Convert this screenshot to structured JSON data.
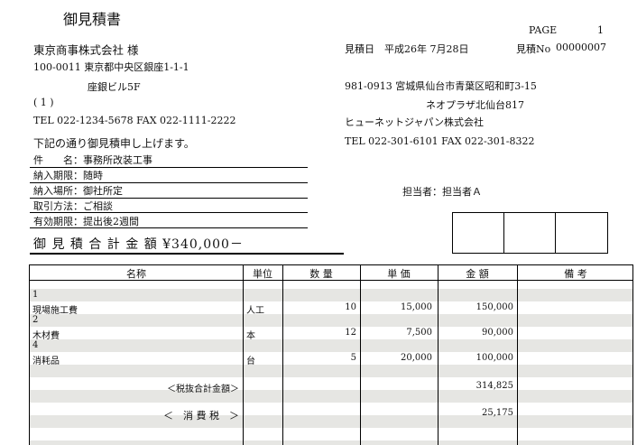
{
  "title": "御見積書",
  "page": {
    "label": "PAGE",
    "number": "1"
  },
  "customer": {
    "name": "東京商事株式会社 様",
    "postal_address": "100-0011 東京都中央区銀座1-1-1",
    "building": "座銀ビル5F",
    "code": "( 1 )",
    "phone_fax": "TEL 022-1234-5678    FAX 022-1111-2222"
  },
  "quote": {
    "date_label": "見積日",
    "date": "平成26年 7月28日",
    "number_label": "見積No",
    "number": "00000007"
  },
  "supplier": {
    "postal_address": "981-0913 宮城県仙台市青葉区昭和町3-15",
    "building": "ネオプラザ北仙台817",
    "name": "ヒューネットジャパン株式会社",
    "phone_fax": "TEL 022-301-6101     FAX 022-301-8322"
  },
  "intro": "下記の通り御見積申し上げます。",
  "conditions": [
    "件　　名：事務所改装工事",
    "納入期限：随時",
    "納入場所：御社所定",
    "取引方法：ご相談",
    "有効期限：提出後2週間"
  ],
  "staff": "担当者：担当者Ａ",
  "total": "御 見 積 合 計 金 額  ¥340,000－",
  "table": {
    "headers": [
      "名称",
      "単位",
      "数 量",
      "単 価",
      "金 額",
      "備 考"
    ],
    "rows": [
      {
        "code": "1",
        "name": "現場施工費",
        "unit": "人工",
        "qty": "10",
        "price": "15,000",
        "amount": "150,000"
      },
      {
        "code": "2",
        "name": "木材費",
        "unit": "本",
        "qty": "12",
        "price": "7,500",
        "amount": "90,000"
      },
      {
        "code": "4",
        "name": "消耗品",
        "unit": "台",
        "qty": "5",
        "price": "20,000",
        "amount": "100,000"
      }
    ],
    "subtotal_label": "＜税抜合計金額＞",
    "subtotal": "314,825",
    "tax_label": "＜　消 費 税　＞",
    "tax": "25,175"
  }
}
